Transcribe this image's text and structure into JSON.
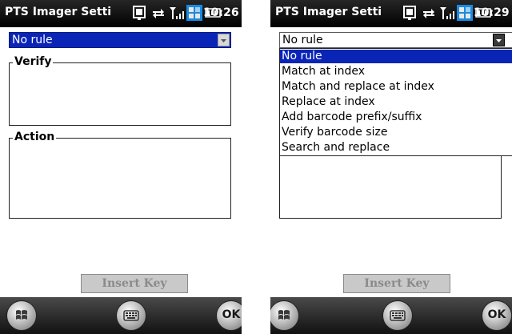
{
  "left": {
    "title": "PTS Imager Setti",
    "time": "10:26",
    "combo_value": "No rule",
    "verify_label": "Verify",
    "action_label": "Action",
    "insert_key_label": "Insert Key",
    "ok_label": "OK"
  },
  "right": {
    "title": "PTS Imager Setti",
    "time": "10:29",
    "combo_value": "No rule",
    "options": [
      "No rule",
      "Match at index",
      "Match and replace at index",
      "Replace at index",
      "Add barcode prefix/suffix",
      "Verify barcode size",
      "Search and replace"
    ],
    "insert_key_label": "Insert Key",
    "ok_label": "OK"
  },
  "colors": {
    "selection": "#0a24b6",
    "title_bar": "#000000",
    "button_disabled": "#c9c9c9"
  },
  "icons": [
    "connectivity-icon",
    "sync-icon",
    "signal-icon",
    "battery-icon",
    "windows-start-icon",
    "keyboard-icon"
  ]
}
